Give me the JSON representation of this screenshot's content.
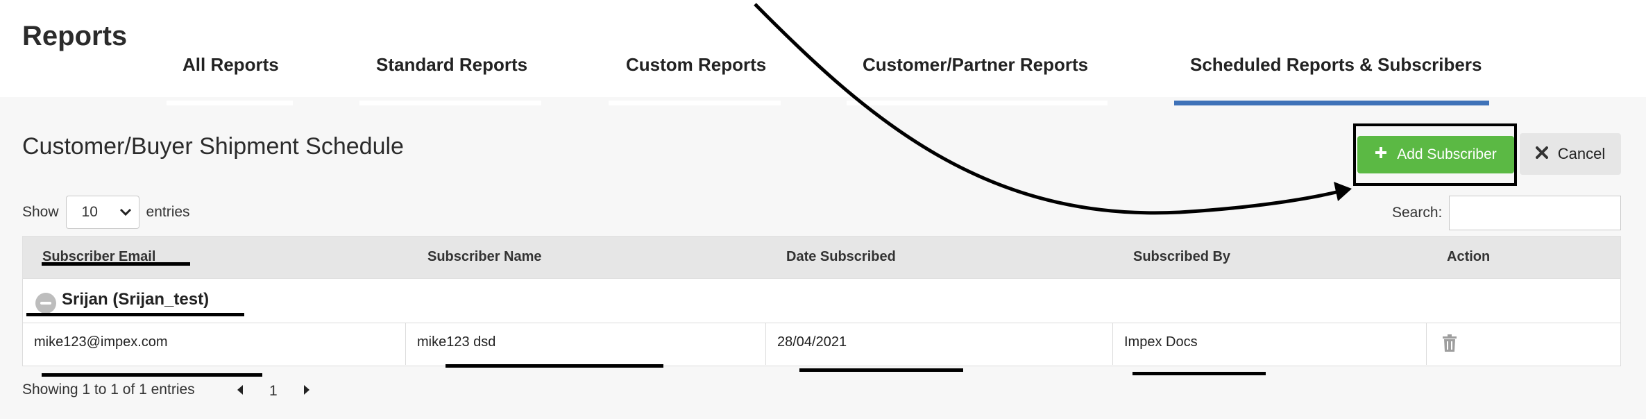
{
  "header": {
    "title": "Reports",
    "tabs": [
      {
        "label": "All Reports",
        "active": false
      },
      {
        "label": "Standard Reports",
        "active": false
      },
      {
        "label": "Custom Reports",
        "active": false
      },
      {
        "label": "Customer/Partner Reports",
        "active": false
      },
      {
        "label": "Scheduled Reports & Subscribers",
        "active": true
      }
    ],
    "active_tab_color": "#3f72b8"
  },
  "section": {
    "title": "Customer/Buyer Shipment Schedule",
    "add_button": {
      "label": "Add Subscriber",
      "icon": "plus-icon",
      "color": "#5bb944"
    },
    "cancel_button": {
      "label": "Cancel",
      "icon": "close-icon"
    }
  },
  "length_control": {
    "show_label": "Show",
    "selected": "10",
    "entries_label": "entries"
  },
  "search": {
    "label": "Search:",
    "value": "",
    "placeholder": ""
  },
  "table": {
    "columns": [
      "Subscriber Email",
      "Subscriber Name",
      "Date Subscribed",
      "Subscribed By",
      "Action"
    ],
    "group": {
      "label": "Srijan (Srijan_test)"
    },
    "rows": [
      {
        "email": "mike123@impex.com",
        "name": "mike123 dsd",
        "date": "28/04/2021",
        "by": "Impex Docs",
        "action_icon": "trash-icon"
      }
    ]
  },
  "footer": {
    "info": "Showing 1 to 1 of 1 entries",
    "current_page": "1"
  }
}
